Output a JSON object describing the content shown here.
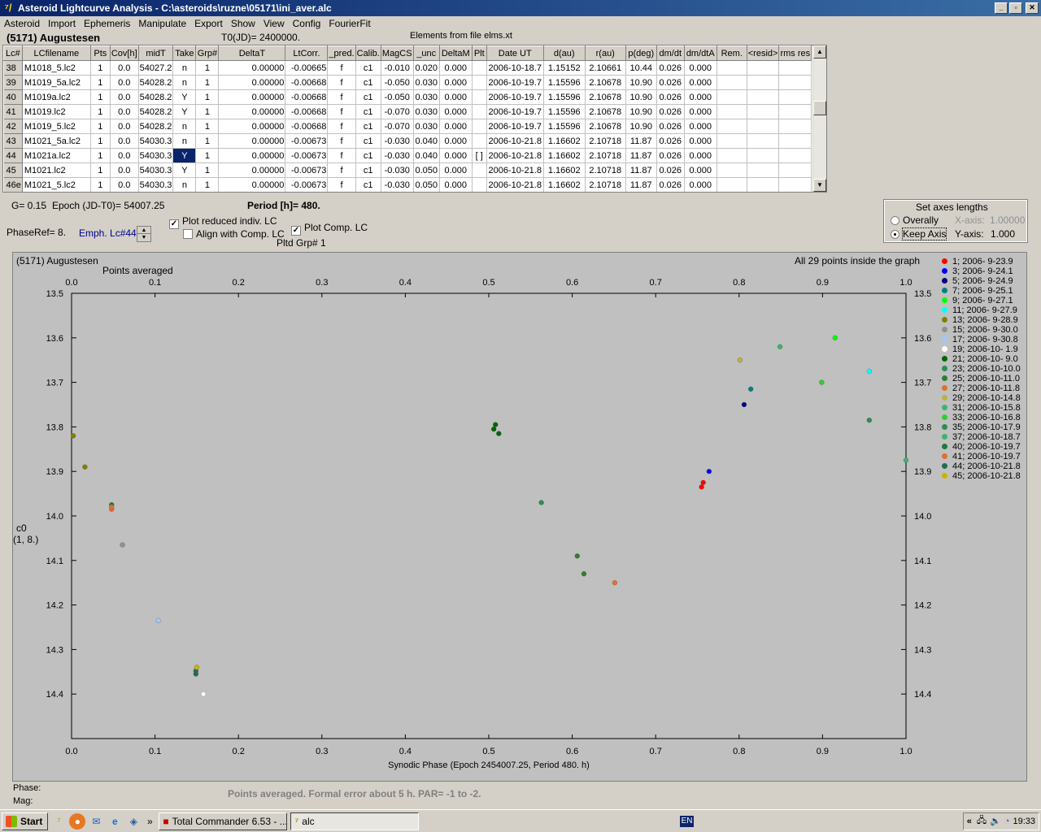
{
  "window": {
    "title": "Asteroid Lightcurve Analysis - C:\\asteroids\\ruzne\\05171\\ini_aver.alc"
  },
  "menu": [
    "Asteroid",
    "Import",
    "Ephemeris",
    "Manipulate",
    "Export",
    "Show",
    "View",
    "Config",
    "FourierFit"
  ],
  "header": {
    "asteroid": "(5171) Augustesen",
    "t0": "T0(JD)= 2400000.",
    "elements": "Elements from file elms.xt"
  },
  "table": {
    "columns": [
      "Lc#",
      "LCfilename",
      "Pts",
      "Cov[h]",
      "midT",
      "Take",
      "Grp#",
      "DeltaT",
      "LtCorr.",
      "_pred.",
      "Calib.",
      "MagCS",
      "_unc",
      "DeltaM",
      "Plt",
      "Date UT",
      "d(au)",
      "r(au)",
      "p(deg)",
      "dm/dt",
      "dm/dtA",
      "Rem.",
      "<resid>",
      "rms res"
    ],
    "rows": [
      [
        "38",
        "M1018_5.lc2",
        "1",
        "0.0",
        "54027.2",
        "n",
        "1",
        "0.00000",
        "-0.00665",
        "f",
        "c1",
        "-0.010",
        "0.020",
        "0.000",
        "",
        "2006-10-18.7",
        "1.15152",
        "2.10661",
        "10.44",
        "0.026",
        "0.000",
        "",
        "",
        ""
      ],
      [
        "39",
        "M1019_5a.lc2",
        "1",
        "0.0",
        "54028.2",
        "n",
        "1",
        "0.00000",
        "-0.00668",
        "f",
        "c1",
        "-0.050",
        "0.030",
        "0.000",
        "",
        "2006-10-19.7",
        "1.15596",
        "2.10678",
        "10.90",
        "0.026",
        "0.000",
        "",
        "",
        ""
      ],
      [
        "40",
        "M1019a.lc2",
        "1",
        "0.0",
        "54028.2",
        "Y",
        "1",
        "0.00000",
        "-0.00668",
        "f",
        "c1",
        "-0.050",
        "0.030",
        "0.000",
        "",
        "2006-10-19.7",
        "1.15596",
        "2.10678",
        "10.90",
        "0.026",
        "0.000",
        "",
        "",
        ""
      ],
      [
        "41",
        "M1019.lc2",
        "1",
        "0.0",
        "54028.2",
        "Y",
        "1",
        "0.00000",
        "-0.00668",
        "f",
        "c1",
        "-0.070",
        "0.030",
        "0.000",
        "",
        "2006-10-19.7",
        "1.15596",
        "2.10678",
        "10.90",
        "0.026",
        "0.000",
        "",
        "",
        ""
      ],
      [
        "42",
        "M1019_5.lc2",
        "1",
        "0.0",
        "54028.2",
        "n",
        "1",
        "0.00000",
        "-0.00668",
        "f",
        "c1",
        "-0.070",
        "0.030",
        "0.000",
        "",
        "2006-10-19.7",
        "1.15596",
        "2.10678",
        "10.90",
        "0.026",
        "0.000",
        "",
        "",
        ""
      ],
      [
        "43",
        "M1021_5a.lc2",
        "1",
        "0.0",
        "54030.3",
        "n",
        "1",
        "0.00000",
        "-0.00673",
        "f",
        "c1",
        "-0.030",
        "0.040",
        "0.000",
        "",
        "2006-10-21.8",
        "1.16602",
        "2.10718",
        "11.87",
        "0.026",
        "0.000",
        "",
        "",
        ""
      ],
      [
        "44",
        "M1021a.lc2",
        "1",
        "0.0",
        "54030.3",
        "Y",
        "1",
        "0.00000",
        "-0.00673",
        "f",
        "c1",
        "-0.030",
        "0.040",
        "0.000",
        "[ ]",
        "2006-10-21.8",
        "1.16602",
        "2.10718",
        "11.87",
        "0.026",
        "0.000",
        "",
        "",
        ""
      ],
      [
        "45",
        "M1021.lc2",
        "1",
        "0.0",
        "54030.3",
        "Y",
        "1",
        "0.00000",
        "-0.00673",
        "f",
        "c1",
        "-0.030",
        "0.050",
        "0.000",
        "",
        "2006-10-21.8",
        "1.16602",
        "2.10718",
        "11.87",
        "0.026",
        "0.000",
        "",
        "",
        ""
      ],
      [
        "46e",
        "M1021_5.lc2",
        "1",
        "0.0",
        "54030.3",
        "n",
        "1",
        "0.00000",
        "-0.00673",
        "f",
        "c1",
        "-0.030",
        "0.050",
        "0.000",
        "",
        "2006-10-21.8",
        "1.16602",
        "2.10718",
        "11.87",
        "0.026",
        "0.000",
        "",
        "",
        ""
      ]
    ]
  },
  "controls": {
    "g_value": "G= 0.15",
    "epoch": "Epoch (JD-T0)= 54007.25",
    "period": "Period [h]= 480.",
    "phaseref": "PhaseRef= 8.",
    "emph": "Emph. Lc#44:",
    "plot_reduced": "Plot reduced indiv. LC",
    "align_comp": "Align with Comp. LC",
    "plot_comp": "Plot Comp. LC",
    "pltd_grp": "Pltd Grp#  1",
    "axes_title": "Set axes lengths",
    "overally": "Overally",
    "keep_axis": "Keep Axis",
    "xaxis_label": "X-axis:",
    "xaxis_value": "1.00000",
    "yaxis_label": "Y-axis:",
    "yaxis_value": "1.000"
  },
  "plot_labels": {
    "title": "(5171) Augustesen",
    "subtitle": "Points averaged",
    "points_inside": "All 29 points inside the graph",
    "ylabel1": "c0",
    "ylabel2": "(1, 8.)"
  },
  "chart_data": {
    "type": "scatter",
    "title": "(5171) Augustesen",
    "xlabel": "Synodic Phase (Epoch 2454007.25, Period 480. h)",
    "ylabel": "c0",
    "xlim": [
      0.0,
      1.0
    ],
    "ylim": [
      14.5,
      13.5
    ],
    "x_ticks": [
      "0.0",
      "0.1",
      "0.2",
      "0.3",
      "0.4",
      "0.5",
      "0.6",
      "0.7",
      "0.8",
      "0.9",
      "1.0"
    ],
    "y_ticks": [
      "13.5",
      "13.6",
      "13.7",
      "13.8",
      "13.9",
      "14.0",
      "14.1",
      "14.2",
      "14.3",
      "14.4"
    ],
    "grid": false,
    "legend_position": "right",
    "series": [
      {
        "name": "1; 2006- 9-23.9",
        "color": "#ff0000",
        "points": [
          [
            0.757,
            13.925
          ],
          [
            0.755,
            13.935
          ]
        ]
      },
      {
        "name": "3; 2006- 9-24.1",
        "color": "#0000ff",
        "points": [
          [
            0.764,
            13.9
          ]
        ]
      },
      {
        "name": "5; 2006- 9-24.9",
        "color": "#000080",
        "points": [
          [
            0.806,
            13.75
          ]
        ]
      },
      {
        "name": "7; 2006- 9-25.1",
        "color": "#008080",
        "points": [
          [
            0.814,
            13.715
          ]
        ]
      },
      {
        "name": "9; 2006- 9-27.1",
        "color": "#00ff00",
        "points": [
          [
            0.915,
            13.6
          ]
        ]
      },
      {
        "name": "11; 2006- 9-27.9",
        "color": "#00ffff",
        "points": [
          [
            0.956,
            13.675
          ]
        ]
      },
      {
        "name": "13; 2006- 9-28.9",
        "color": "#808000",
        "points": [
          [
            0.002,
            13.82
          ],
          [
            0.016,
            13.89
          ]
        ]
      },
      {
        "name": "15; 2006- 9-30.0",
        "color": "#909090",
        "points": [
          [
            0.061,
            14.065
          ]
        ]
      },
      {
        "name": "17; 2006- 9-30.8",
        "color": "#a0c8ff",
        "points": [
          [
            0.104,
            14.235
          ]
        ]
      },
      {
        "name": "19; 2006-10- 1.9",
        "color": "#ffffff",
        "points": [
          [
            0.158,
            14.4
          ]
        ]
      },
      {
        "name": "21; 2006-10- 9.0",
        "color": "#006400",
        "points": [
          [
            0.508,
            13.795
          ],
          [
            0.506,
            13.805
          ],
          [
            0.512,
            13.815
          ]
        ]
      },
      {
        "name": "23; 2006-10-10.0",
        "color": "#2e8b57",
        "points": [
          [
            0.563,
            13.97
          ]
        ]
      },
      {
        "name": "25; 2006-10-11.0",
        "color": "#2e7d32",
        "points": [
          [
            0.606,
            14.09
          ],
          [
            0.614,
            14.13
          ]
        ]
      },
      {
        "name": "27; 2006-10-11.8",
        "color": "#e07030",
        "points": [
          [
            0.651,
            14.15
          ],
          [
            0.048,
            13.985
          ]
        ]
      },
      {
        "name": "29; 2006-10-14.8",
        "color": "#bdb040",
        "points": [
          [
            0.801,
            13.65
          ]
        ]
      },
      {
        "name": "31; 2006-10-15.8",
        "color": "#3cb371",
        "points": [
          [
            0.849,
            13.62
          ]
        ]
      },
      {
        "name": "33; 2006-10-16.8",
        "color": "#32cd32",
        "points": [
          [
            0.899,
            13.7
          ]
        ]
      },
      {
        "name": "35; 2006-10-17.9",
        "color": "#2e8b57",
        "points": [
          [
            0.956,
            13.785
          ]
        ]
      },
      {
        "name": "37; 2006-10-18.7",
        "color": "#3cb371",
        "points": [
          [
            1.0,
            13.875
          ]
        ]
      },
      {
        "name": "40; 2006-10-19.7",
        "color": "#1e7a3c",
        "points": [
          [
            0.048,
            13.975
          ]
        ]
      },
      {
        "name": "41; 2006-10-19.7",
        "color": "#e07030",
        "points": [
          [
            0.048,
            13.98
          ]
        ]
      },
      {
        "name": "44; 2006-10-21.8",
        "color": "#1e6e50",
        "points": [
          [
            0.149,
            14.355
          ],
          [
            0.149,
            14.348
          ]
        ]
      },
      {
        "name": "45; 2006-10-21.8",
        "color": "#c8b400",
        "points": [
          [
            0.15,
            14.34
          ]
        ]
      }
    ]
  },
  "status": {
    "phase": "Phase:",
    "mag": "Mag:",
    "message": "Points averaged. Formal error about 5 h.  PAR= -1 to -2."
  },
  "taskbar": {
    "start": "Start",
    "quicklaunch_more": "»",
    "tasks": [
      "Total Commander 6.53 - ...",
      "alc"
    ],
    "lang": "EN",
    "tray_arrows": "«",
    "clock": "19:33"
  }
}
